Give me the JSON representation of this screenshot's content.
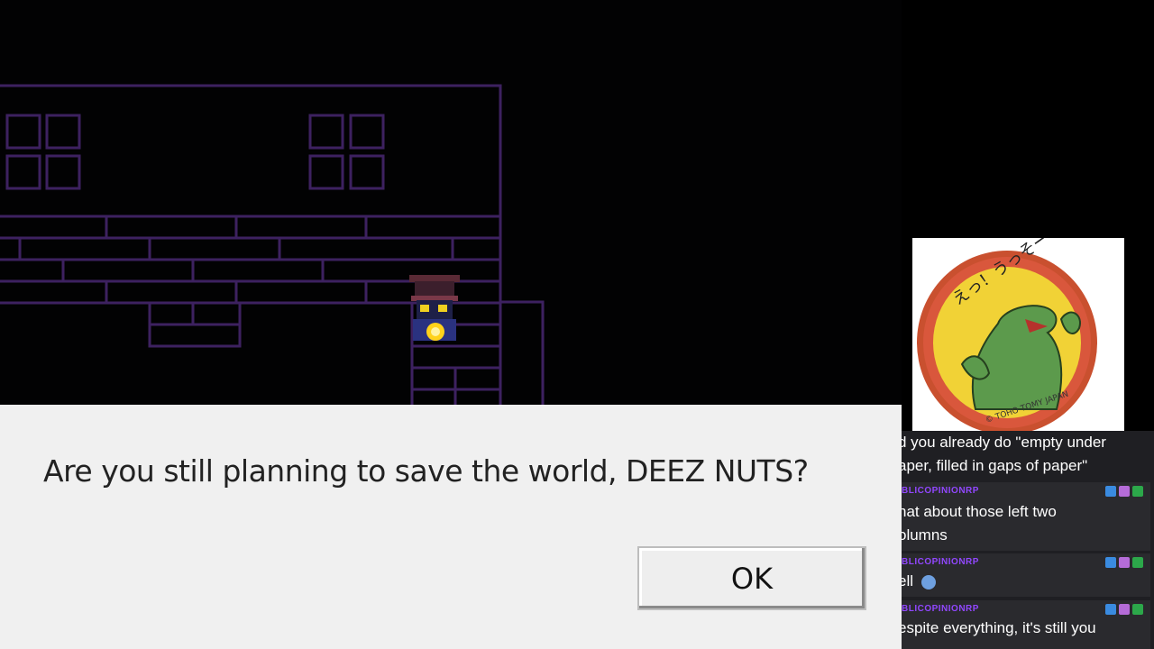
{
  "dialog": {
    "message": "Are you still planning to save the world, DEEZ NUTS?",
    "ok_label": "OK"
  },
  "chat": {
    "messages": [
      {
        "user": "",
        "text": "d you already do \"empty under"
      },
      {
        "user": "",
        "text": "aper, filled in gaps of paper\""
      },
      {
        "user": "BLICOPINIONRP",
        "text": "hat about those left two"
      },
      {
        "user": "",
        "text": "olumns"
      },
      {
        "user": "BLICOPINIONRP",
        "text": "ell"
      },
      {
        "user": "BLICOPINIONRP",
        "text": "espite everything, it's still you"
      }
    ]
  },
  "overlay_image": {
    "badge_text_japanese": "えっ！うっそー",
    "copyright": "© TOHO  TOMY JAPAN"
  },
  "colors": {
    "building_outline": "#4a2a6e",
    "dialog_bg": "#f0f0f0",
    "chat_username": "#9147ff",
    "chat_bg": "#1f1f23",
    "pin_rim": "#d9573c",
    "pin_face": "#f1d236",
    "monster": "#5c9a4c"
  }
}
